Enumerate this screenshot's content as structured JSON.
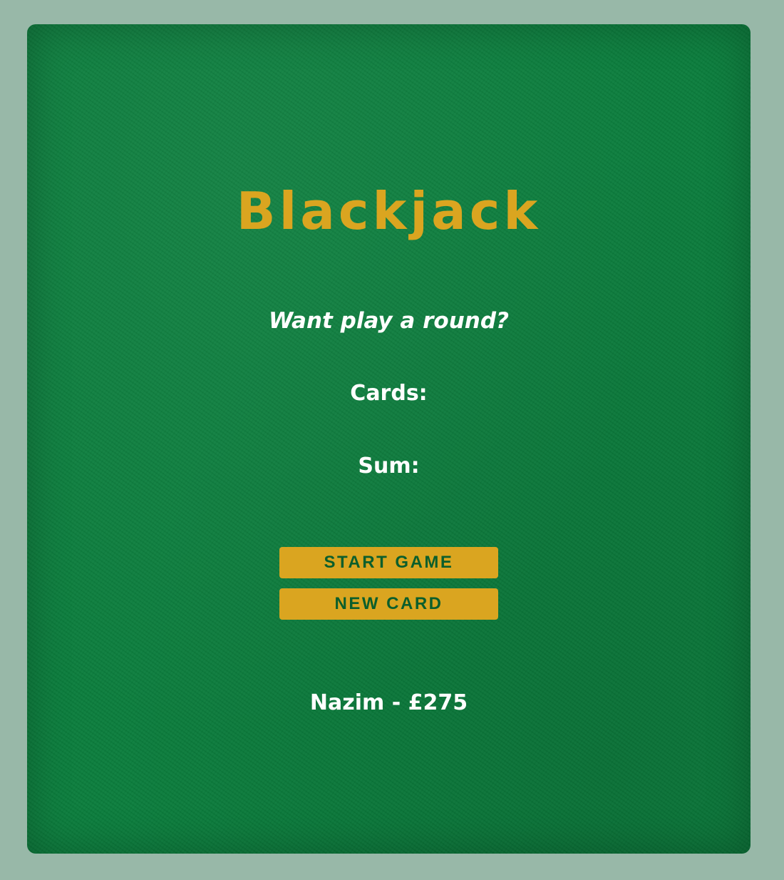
{
  "game": {
    "title": "Blackjack",
    "message": "Want play a round?",
    "cards_label": "Cards:",
    "sum_label": "Sum:",
    "start_button": "START GAME",
    "new_card_button": "NEW CARD",
    "player": "Nazim - £275"
  },
  "colors": {
    "background": "#98b8a8",
    "table_felt": "#0a7d3c",
    "accent_gold": "#daa520",
    "button_text": "#0b5e2c",
    "text": "#ffffff"
  }
}
